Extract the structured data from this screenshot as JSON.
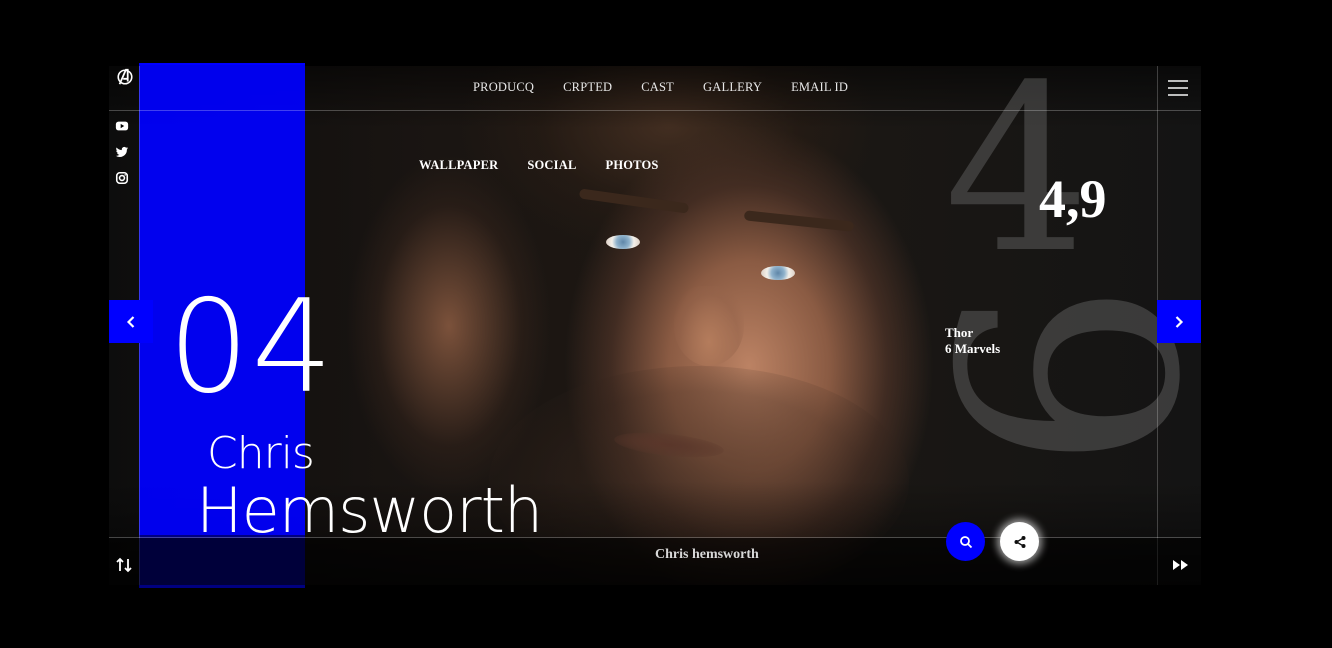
{
  "nav": {
    "top": [
      "PRODUCQ",
      "CRPTED",
      "CAST",
      "GALLERY",
      "EMAIL ID"
    ],
    "sub": [
      "WALLPAPER",
      "SOCIAL",
      "PHOTOS"
    ]
  },
  "social_icons": [
    "youtube-icon",
    "twitter-icon",
    "instagram-icon"
  ],
  "hero": {
    "number": "04",
    "first_name": "Chris",
    "last_name": "Hemsworth",
    "rating": "4,9",
    "info_line1": "Thor",
    "info_line2": "6  Marvels",
    "background_glyphs": [
      "4",
      "6"
    ],
    "bottom_title": "Chris hemsworth"
  },
  "colors": {
    "accent": "#0000ff",
    "background": "#000000",
    "text": "#ffffff"
  }
}
